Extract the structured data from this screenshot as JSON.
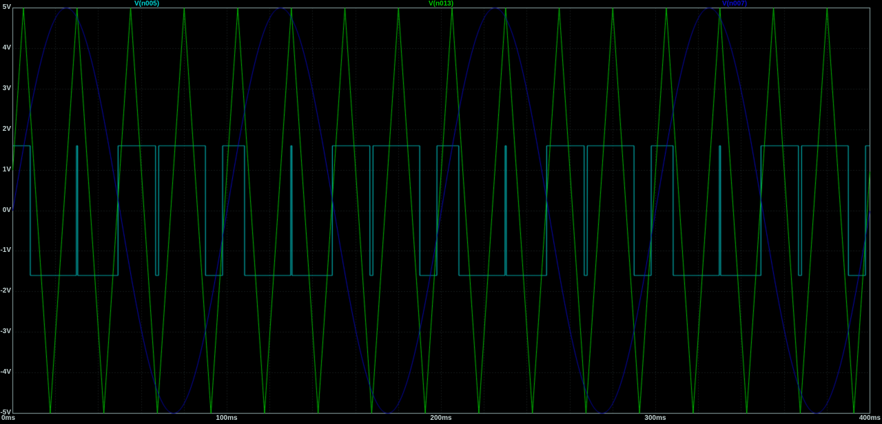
{
  "window": {
    "background_color": "#000000",
    "border_color": "#8fa8a8",
    "grid_color": "#263434",
    "axis_label_color": "#c2d2d2"
  },
  "chart_data": {
    "type": "line",
    "title": "",
    "xlabel": "",
    "ylabel": "",
    "x_range_ms": [
      0,
      400
    ],
    "y_range_V": [
      -5,
      5
    ],
    "grid": true,
    "legend_position": "top",
    "x_ticks": [
      {
        "t": 0,
        "label": "0ms"
      },
      {
        "t": 100,
        "label": "100ms"
      },
      {
        "t": 200,
        "label": "200ms"
      },
      {
        "t": 300,
        "label": "300ms"
      },
      {
        "t": 400,
        "label": "400ms"
      }
    ],
    "y_ticks": [
      {
        "v": 5,
        "label": "5V"
      },
      {
        "v": 4,
        "label": "4V"
      },
      {
        "v": 3,
        "label": "3V"
      },
      {
        "v": 2,
        "label": "2V"
      },
      {
        "v": 1,
        "label": "1V"
      },
      {
        "v": 0,
        "label": "0V"
      },
      {
        "v": -1,
        "label": "-1V"
      },
      {
        "v": -2,
        "label": "-2V"
      },
      {
        "v": -3,
        "label": "-3V"
      },
      {
        "v": -4,
        "label": "-4V"
      },
      {
        "v": -5,
        "label": "-5V"
      }
    ],
    "minor_grid_step_ms": 20,
    "minor_grid_step_V": 1,
    "series": [
      {
        "name": "V(n005)",
        "color": "#00d2d2",
        "waveform": "pwm",
        "high_V": 1.6,
        "low_V": -1.6,
        "rule": "high when triangle carrier >= sine reference"
      },
      {
        "name": "V(n013)",
        "color": "#00c800",
        "waveform": "triangle",
        "amplitude_V": 5,
        "period_ms": 25,
        "peak_at_ms": 5
      },
      {
        "name": "V(n007)",
        "color": "#0a0ad2",
        "waveform": "sine",
        "amplitude_V": 5,
        "period_ms": 100,
        "phase_deg": 0
      }
    ]
  }
}
